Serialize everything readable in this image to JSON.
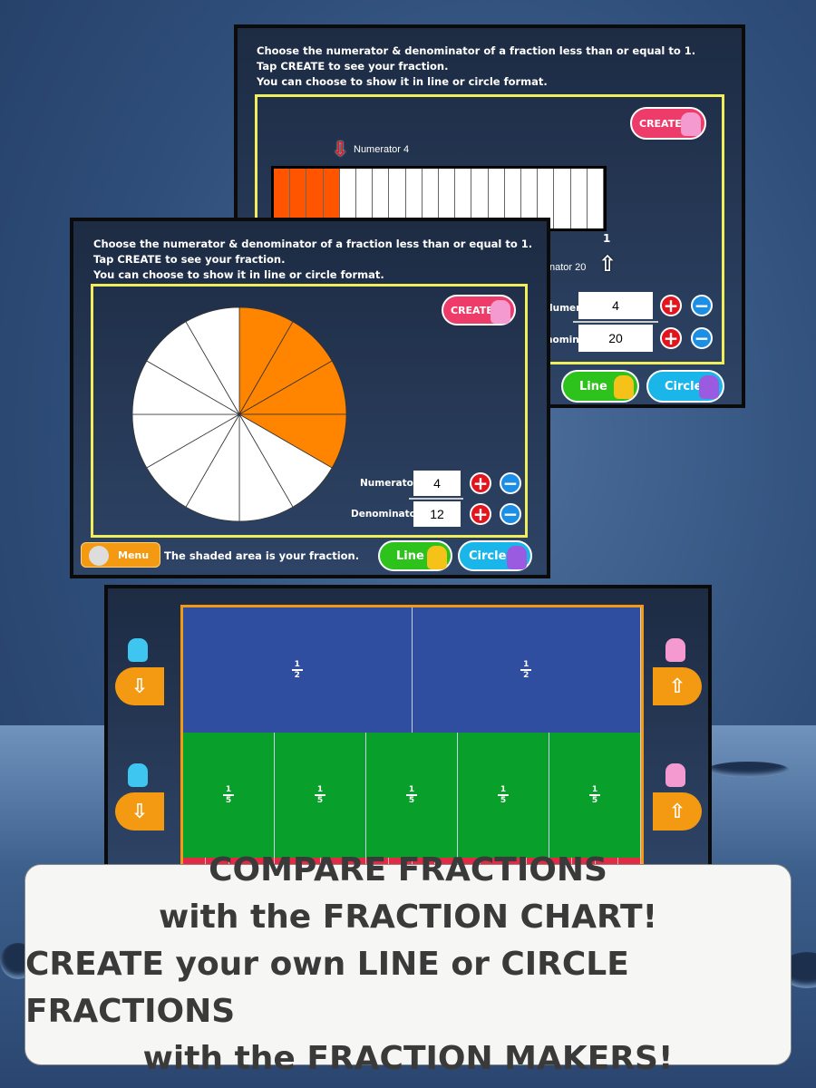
{
  "instructions": [
    "Choose the numerator & denominator of a fraction less than or equal to 1.",
    "Tap CREATE to see your fraction.",
    "You can choose to show it in line or circle format."
  ],
  "line_maker": {
    "create_label": "CREATE",
    "numerator_marker": "Numerator 4",
    "denominator_marker": "nator 20",
    "end_label": "1",
    "numerator_label": "lumerator",
    "denominator_label": "nominator",
    "numerator": 4,
    "denominator": 20,
    "line_label": "Line",
    "circle_label": "Circle",
    "fill_color": "#ff5500"
  },
  "circle_maker": {
    "create_label": "CREATE",
    "numerator_label": "Numerator",
    "denominator_label": "Denominator",
    "numerator": 4,
    "denominator": 12,
    "menu_label": "Menu",
    "status": "The shaded area is your fraction.",
    "line_label": "Line",
    "circle_label": "Circle",
    "fill_color": "#ff8400"
  },
  "fraction_chart": {
    "rows": [
      {
        "denominator": 2,
        "color": "#304ea0",
        "label_num": "1",
        "label_den": "2"
      },
      {
        "denominator": 5,
        "color": "#08a02a",
        "label_num": "1",
        "label_den": "5"
      }
    ],
    "partial_row_color": "#e22a44"
  },
  "caption": [
    "COMPARE FRACTIONS",
    "with the FRACTION CHART!",
    "CREATE your own LINE or CIRCLE FRACTIONS",
    "with the FRACTION MAKERS!"
  ]
}
